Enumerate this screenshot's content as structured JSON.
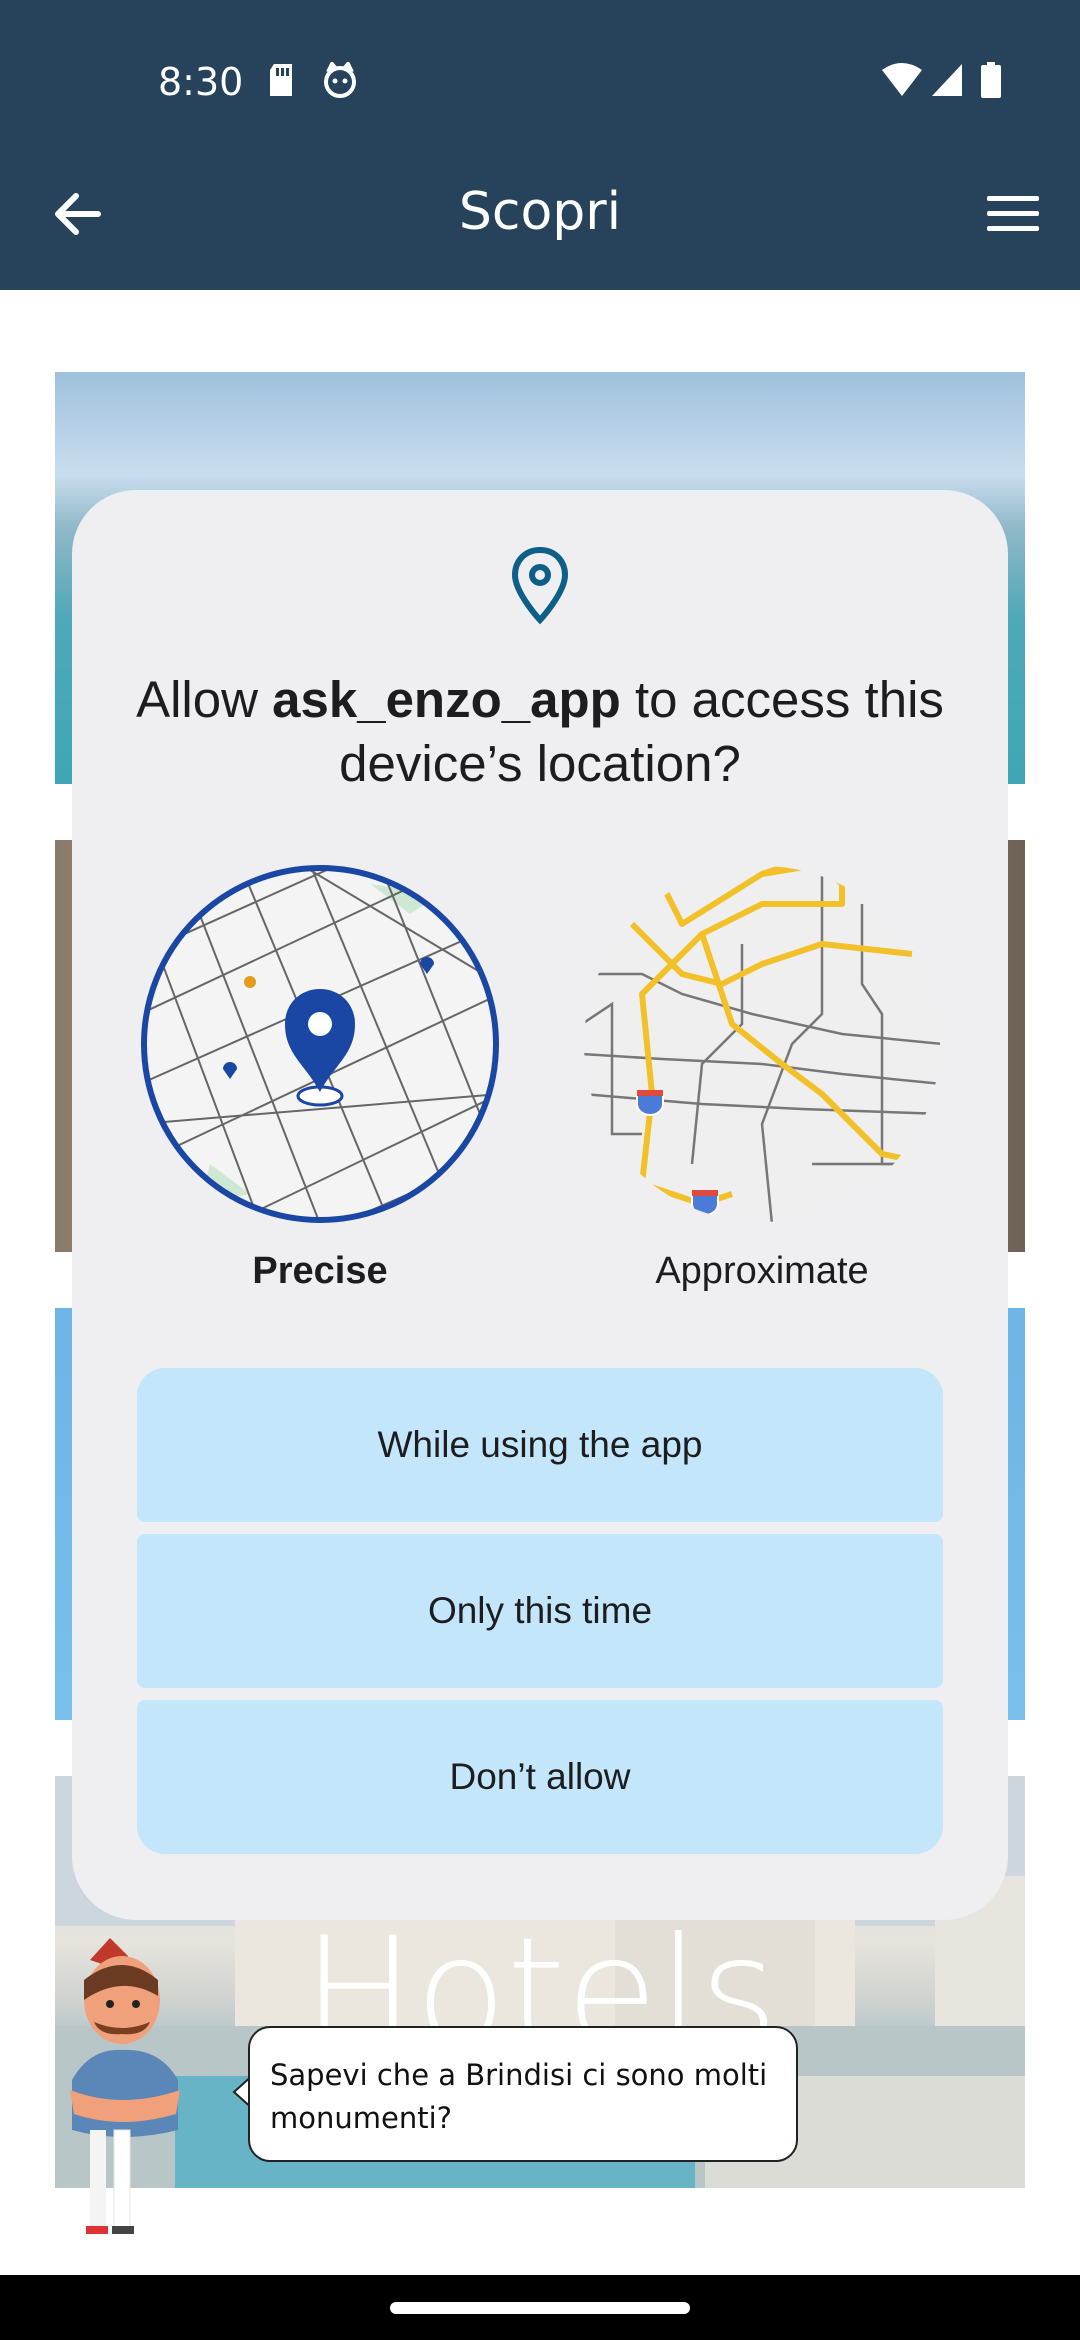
{
  "status_bar": {
    "time": "8:30",
    "left_icons": [
      "sd-card-icon",
      "cat-face-icon"
    ],
    "right_icons": [
      "wifi-icon",
      "signal-icon",
      "battery-icon"
    ]
  },
  "app_bar": {
    "title": "Scopri",
    "back_icon": "arrow-left-icon",
    "menu_icon": "hamburger-menu-icon",
    "color": "#26435b"
  },
  "background_cards": [
    {
      "title": ""
    },
    {
      "title": ""
    },
    {
      "title": ""
    },
    {
      "title": "Hotels"
    }
  ],
  "permission_dialog": {
    "icon": "location-pin-icon",
    "title_prefix": "Allow ",
    "app_name": "ask_enzo_app",
    "title_suffix": " to access this device’s location?",
    "options": {
      "precise_label": "Precise",
      "approximate_label": "Approximate",
      "selected": "Precise"
    },
    "buttons": {
      "while_using": "While using the app",
      "only_this_time": "Only this time",
      "dont_allow": "Don’t allow"
    },
    "button_color": "#c3e6fb",
    "accent_color": "#1a47a3"
  },
  "assistant": {
    "bubble_text": "Sapevi che a Brindisi ci sono molti monumenti?"
  }
}
